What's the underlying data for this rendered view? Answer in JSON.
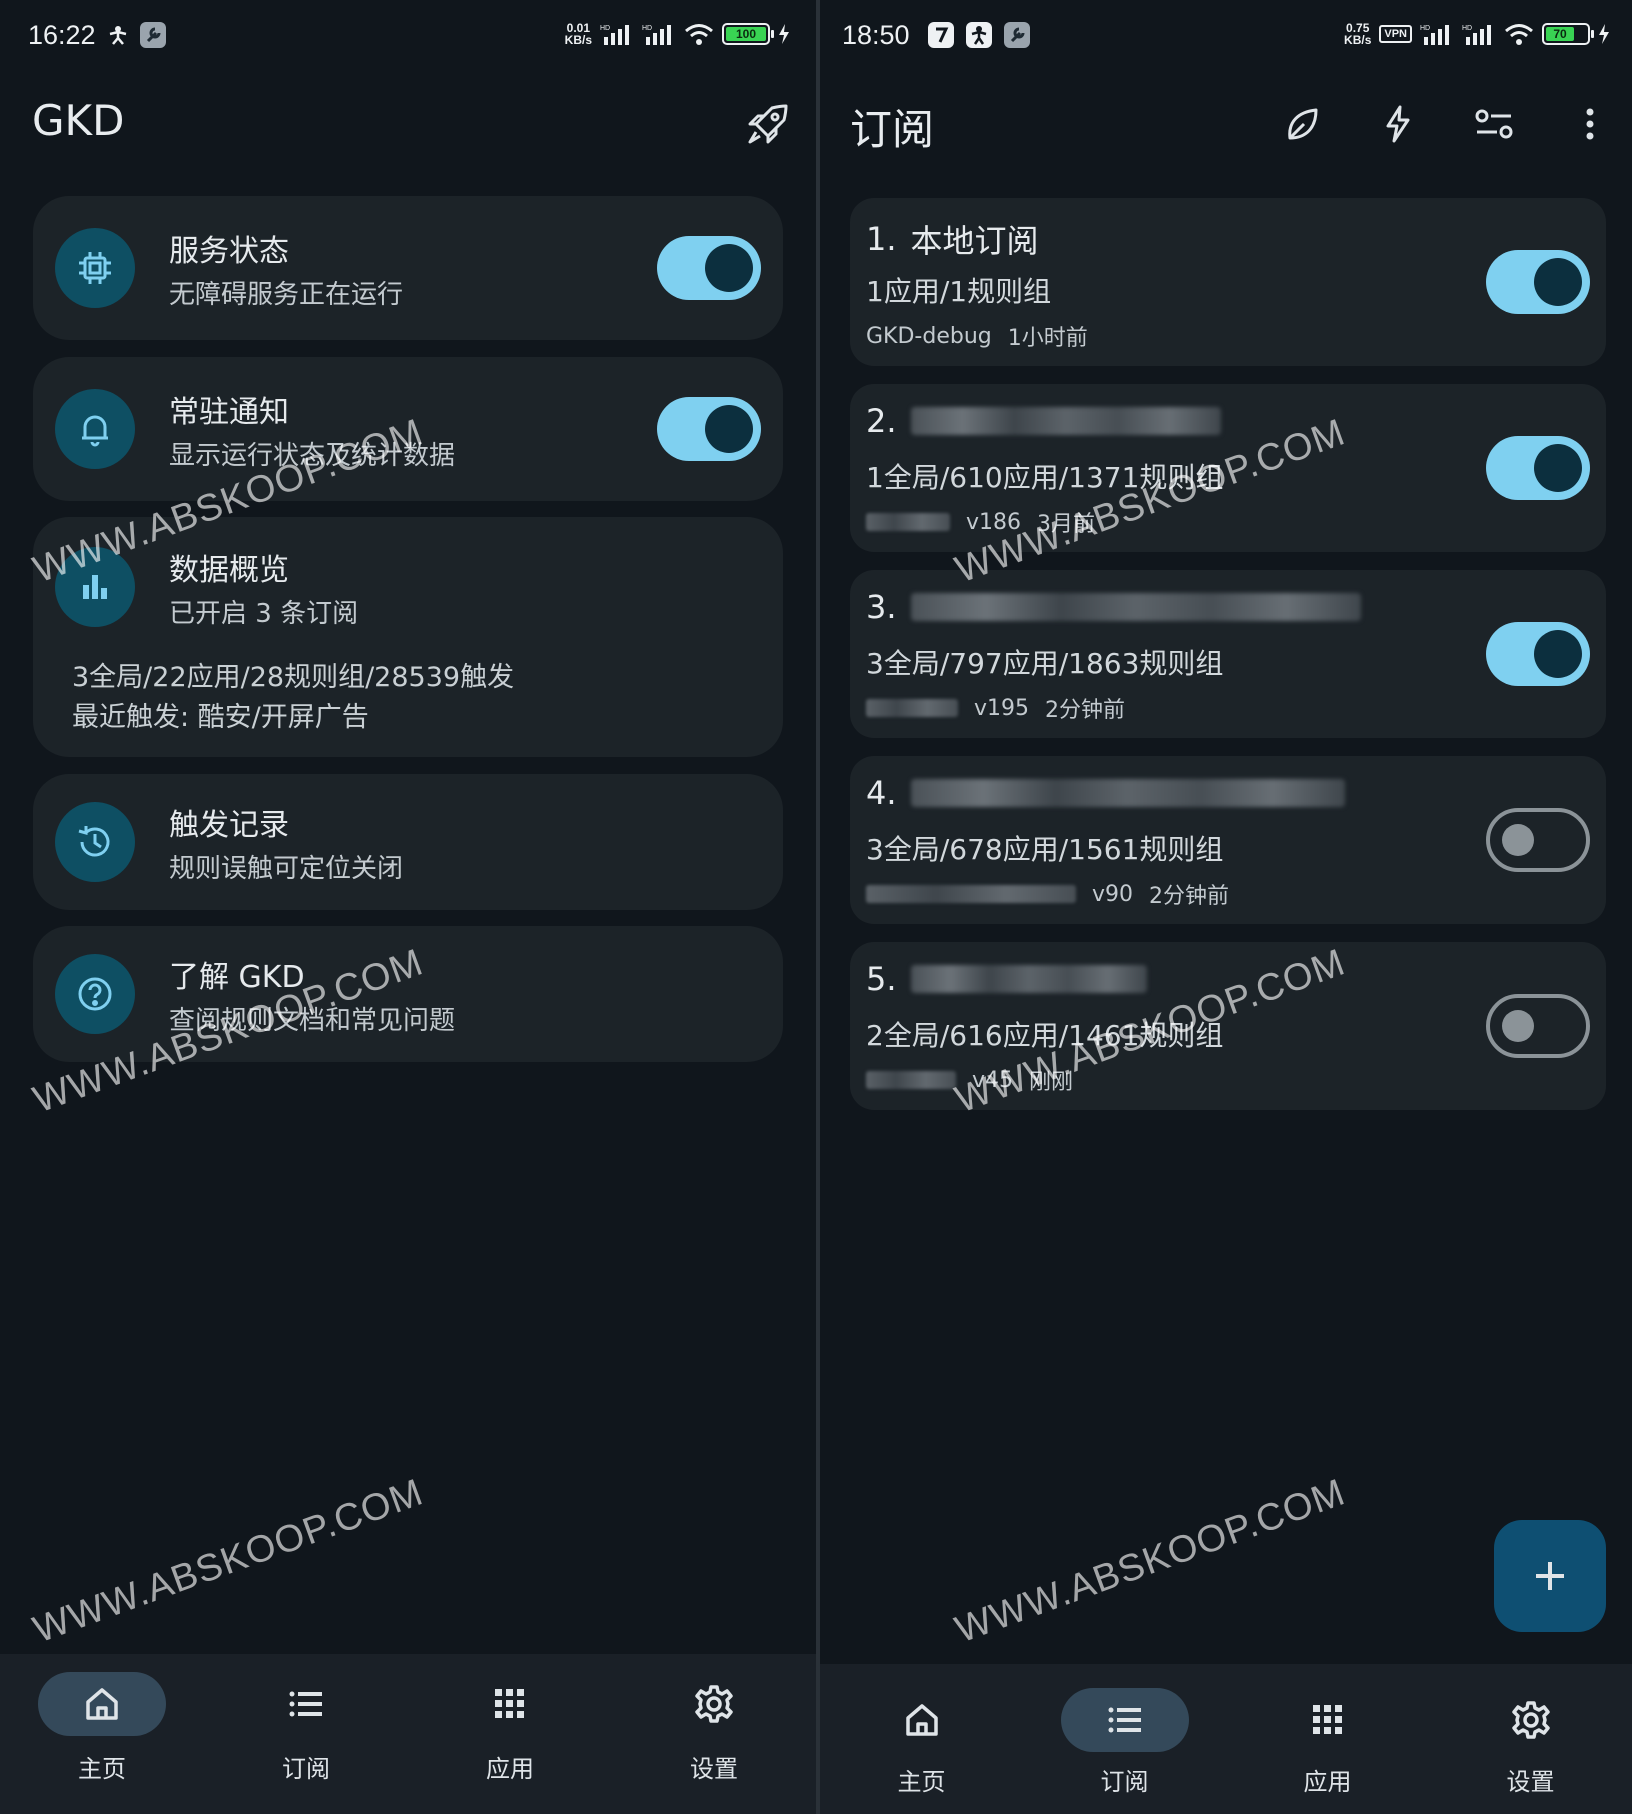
{
  "left": {
    "status_bar": {
      "time": "16:22",
      "speed_value": "0.01",
      "speed_unit": "KB/s",
      "battery": "100"
    },
    "title": "GKD",
    "cards": {
      "service": {
        "title": "服务状态",
        "subtitle": "无障碍服务正在运行",
        "enabled": true
      },
      "notify": {
        "title": "常驻通知",
        "subtitle": "显示运行状态及统计数据",
        "enabled": true
      },
      "overview": {
        "title": "数据概览",
        "subtitle": "已开启 3 条订阅",
        "stats": "3全局/22应用/28规则组/28539触发",
        "recent": "最近触发: 酷安/开屏广告"
      },
      "history": {
        "title": "触发记录",
        "subtitle": "规则误触可定位关闭"
      },
      "about": {
        "title": "了解 GKD",
        "subtitle": "查阅规则文档和常见问题"
      }
    },
    "nav": [
      {
        "label": "主页",
        "icon": "home-icon",
        "active": true
      },
      {
        "label": "订阅",
        "icon": "list-icon",
        "active": false
      },
      {
        "label": "应用",
        "icon": "apps-icon",
        "active": false
      },
      {
        "label": "设置",
        "icon": "gear-icon",
        "active": false
      }
    ]
  },
  "right": {
    "status_bar": {
      "time": "18:50",
      "speed_value": "0.75",
      "speed_unit": "KB/s",
      "vpn": "VPN",
      "battery": "70"
    },
    "title": "订阅",
    "subscriptions": [
      {
        "index": "1.",
        "name": "本地订阅",
        "counts": "1应用/1规则组",
        "source": "GKD-debug",
        "version": "",
        "time": "1小时前",
        "enabled": true
      },
      {
        "index": "2.",
        "name": "",
        "counts": "1全局/610应用/1371规则组",
        "source": "",
        "version": "v186",
        "time": "3月前",
        "enabled": true
      },
      {
        "index": "3.",
        "name": "",
        "counts": "3全局/797应用/1863规则组",
        "source": "",
        "version": "v195",
        "time": "2分钟前",
        "enabled": true
      },
      {
        "index": "4.",
        "name": "",
        "counts": "3全局/678应用/1561规则组",
        "source": "",
        "version": "v90",
        "time": "2分钟前",
        "enabled": false
      },
      {
        "index": "5.",
        "name": "",
        "counts": "2全局/616应用/1461规则组",
        "source": "",
        "version": "v45",
        "time": "刚刚",
        "enabled": false
      }
    ],
    "fab_icon": "plus-icon",
    "nav": [
      {
        "label": "主页",
        "icon": "home-icon",
        "active": false
      },
      {
        "label": "订阅",
        "icon": "list-icon",
        "active": true
      },
      {
        "label": "应用",
        "icon": "apps-icon",
        "active": false
      },
      {
        "label": "设置",
        "icon": "gear-icon",
        "active": false
      }
    ]
  },
  "watermark": "WWW.ABSKOOP.COM",
  "colors": {
    "background": "#10161c",
    "card": "#1c2328",
    "accent": "#7fd0f0",
    "icon_circle": "#0e4f63",
    "fab": "#0e4f72",
    "nav_active": "#34495a"
  }
}
